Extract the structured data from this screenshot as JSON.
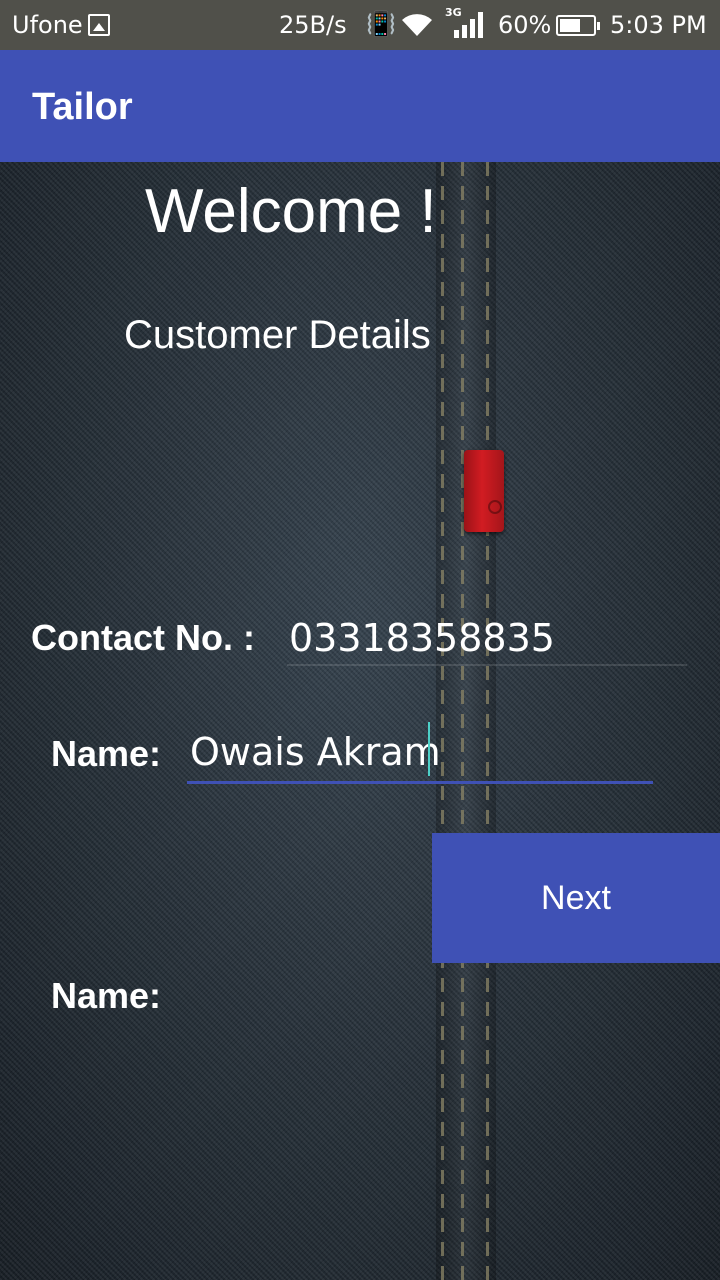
{
  "status_bar": {
    "carrier": "Ufone",
    "speed": "25B/s",
    "network_type": "3G",
    "battery": "60%",
    "time": "5:03 PM",
    "icons": [
      "image-icon",
      "vibrate-icon",
      "wifi-icon",
      "signal-icon",
      "battery-icon"
    ]
  },
  "app_bar": {
    "title": "Tailor",
    "color": "#3f51b5"
  },
  "main": {
    "welcome": "Welcome !",
    "subtitle": "Customer Details",
    "contact_label": "Contact No. :",
    "contact_value": "03318358835",
    "name_label": "Name:",
    "name_value": "Owais Akram",
    "next_label": "Next",
    "second_name_label": "Name:"
  },
  "colors": {
    "accent": "#3f51b5",
    "status_bar": "#50504a",
    "cursor": "#4dd0c8"
  }
}
